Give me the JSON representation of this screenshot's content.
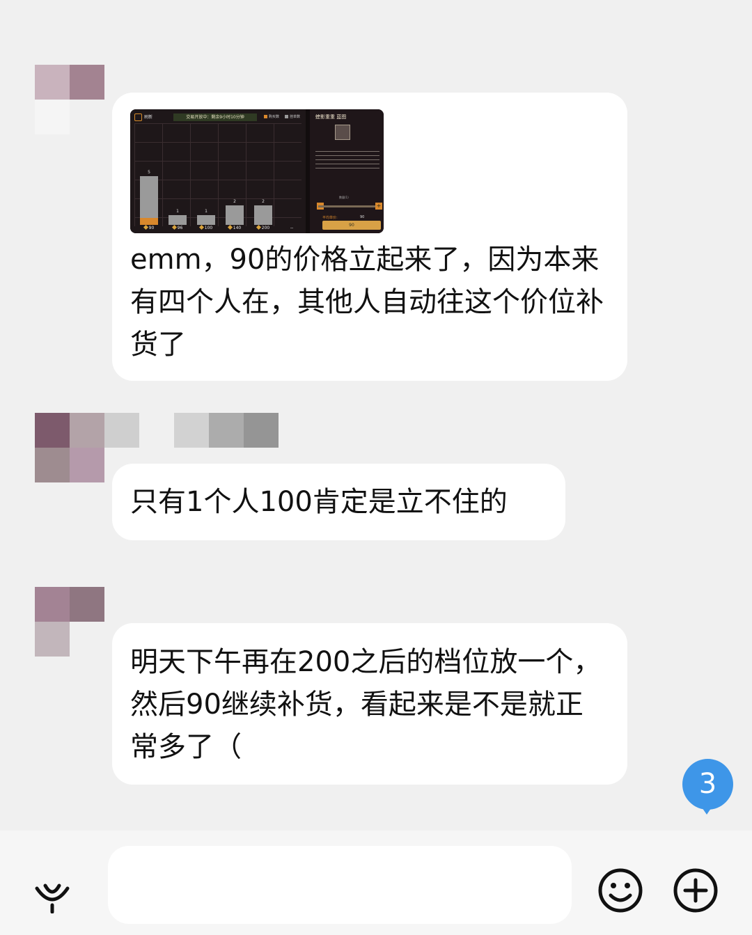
{
  "colors": {
    "background": "#f0f0f0",
    "bubble": "#ffffff",
    "badge": "#3e96e8",
    "game_orange": "#d9882c"
  },
  "messages": [
    {
      "text": "emm，90的价格立起来了，因为本来有四个人在，其他人自动往这个价位补货了",
      "has_image": true
    },
    {
      "text": "只有1个人100肯定是立不住的"
    },
    {
      "text": "明天下午再在200之后的档位放一个，然后90继续补货，看起来是不是就正常多了（"
    }
  ],
  "game_screenshot": {
    "refresh_label": "刷新",
    "status_bar": "交易开放中：剩余9小时10分钟",
    "legend_buy": "购买数",
    "legend_sell": "挂单数",
    "item_title": "蝰影重重 蓝图",
    "quantity_label": "数量(1)",
    "avg_price_label": "平均单价:",
    "avg_price_value": "90",
    "buy_button": "90",
    "chart_data": {
      "type": "bar",
      "categories": [
        "90",
        "96",
        "100",
        "140",
        "200",
        "--"
      ],
      "values": [
        5,
        1,
        1,
        2,
        2,
        0
      ],
      "count_labels": [
        "5",
        "1",
        "1",
        "2",
        "2",
        ""
      ]
    }
  },
  "unread_badge": "3",
  "input": {
    "placeholder": ""
  },
  "icons": {
    "voice": "voice-icon",
    "emoji": "emoji-icon",
    "plus": "plus-icon"
  }
}
